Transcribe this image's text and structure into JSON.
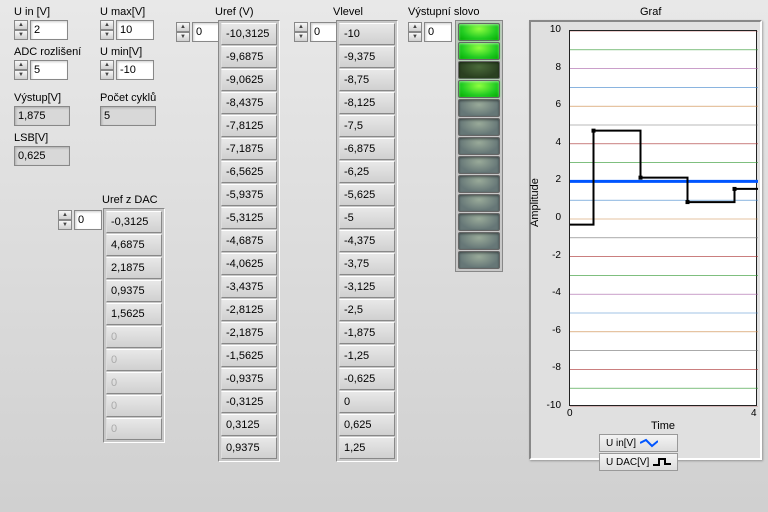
{
  "inputs": {
    "u_in": {
      "label": "U in [V]",
      "value": "2"
    },
    "adc_res": {
      "label": "ADC rozlišení",
      "value": "5"
    },
    "u_max": {
      "label": "U max[V]",
      "value": "10"
    },
    "u_min": {
      "label": "U min[V]",
      "value": "-10"
    }
  },
  "outputs": {
    "vystup": {
      "label": "Výstup[V]",
      "value": "1,875"
    },
    "lsb": {
      "label": "LSB[V]",
      "value": "0,625"
    },
    "pocet_cyklu": {
      "label": "Počet cyklů",
      "value": "5"
    }
  },
  "uref_dac": {
    "label": "Uref z DAC",
    "index": "0",
    "values": [
      "-0,3125",
      "4,6875",
      "2,1875",
      "0,9375",
      "1,5625",
      "0",
      "0",
      "0",
      "0",
      "0"
    ],
    "active_count": 5
  },
  "uref": {
    "label": "Uref (V)",
    "index": "0",
    "values": [
      "-10,3125",
      "-9,6875",
      "-9,0625",
      "-8,4375",
      "-7,8125",
      "-7,1875",
      "-6,5625",
      "-5,9375",
      "-5,3125",
      "-4,6875",
      "-4,0625",
      "-3,4375",
      "-2,8125",
      "-2,1875",
      "-1,5625",
      "-0,9375",
      "-0,3125",
      "0,3125",
      "0,9375"
    ]
  },
  "vlevel": {
    "label": "Vlevel",
    "index": "0",
    "values": [
      "-10",
      "-9,375",
      "-8,75",
      "-8,125",
      "-7,5",
      "-6,875",
      "-6,25",
      "-5,625",
      "-5",
      "-4,375",
      "-3,75",
      "-3,125",
      "-2,5",
      "-1,875",
      "-1,25",
      "-0,625",
      "0",
      "0,625",
      "1,25"
    ]
  },
  "leds": {
    "label": "Výstupní slovo",
    "index": "0",
    "states": [
      "on",
      "on",
      "dim",
      "on",
      "off",
      "off",
      "off",
      "off",
      "off",
      "off",
      "off",
      "off",
      "off"
    ]
  },
  "graph": {
    "title": "Graf",
    "ylabel": "Amplitude",
    "xlabel": "Time",
    "legend": [
      "U in[V]",
      "U DAC[V]"
    ],
    "y_ticks": [
      "10",
      "8",
      "6",
      "4",
      "2",
      "0",
      "-2",
      "-4",
      "-6",
      "-8",
      "-10"
    ],
    "x_ticks": [
      "0",
      "4"
    ]
  },
  "chart_data": {
    "type": "line",
    "title": "Graf",
    "xlabel": "Time",
    "ylabel": "Amplitude",
    "xlim": [
      0,
      4
    ],
    "ylim": [
      -10,
      10
    ],
    "series": [
      {
        "name": "U in[V]",
        "color": "#0055ff",
        "x": [
          0,
          4
        ],
        "y": [
          2,
          2
        ]
      },
      {
        "name": "U DAC[V]",
        "color": "#000000",
        "x": [
          0,
          0.5,
          0.5,
          1.5,
          1.5,
          2.5,
          2.5,
          3.5,
          3.5,
          4
        ],
        "y": [
          -0.3,
          -0.3,
          4.7,
          4.7,
          2.2,
          2.2,
          0.9,
          0.9,
          1.6,
          1.6
        ]
      }
    ]
  }
}
